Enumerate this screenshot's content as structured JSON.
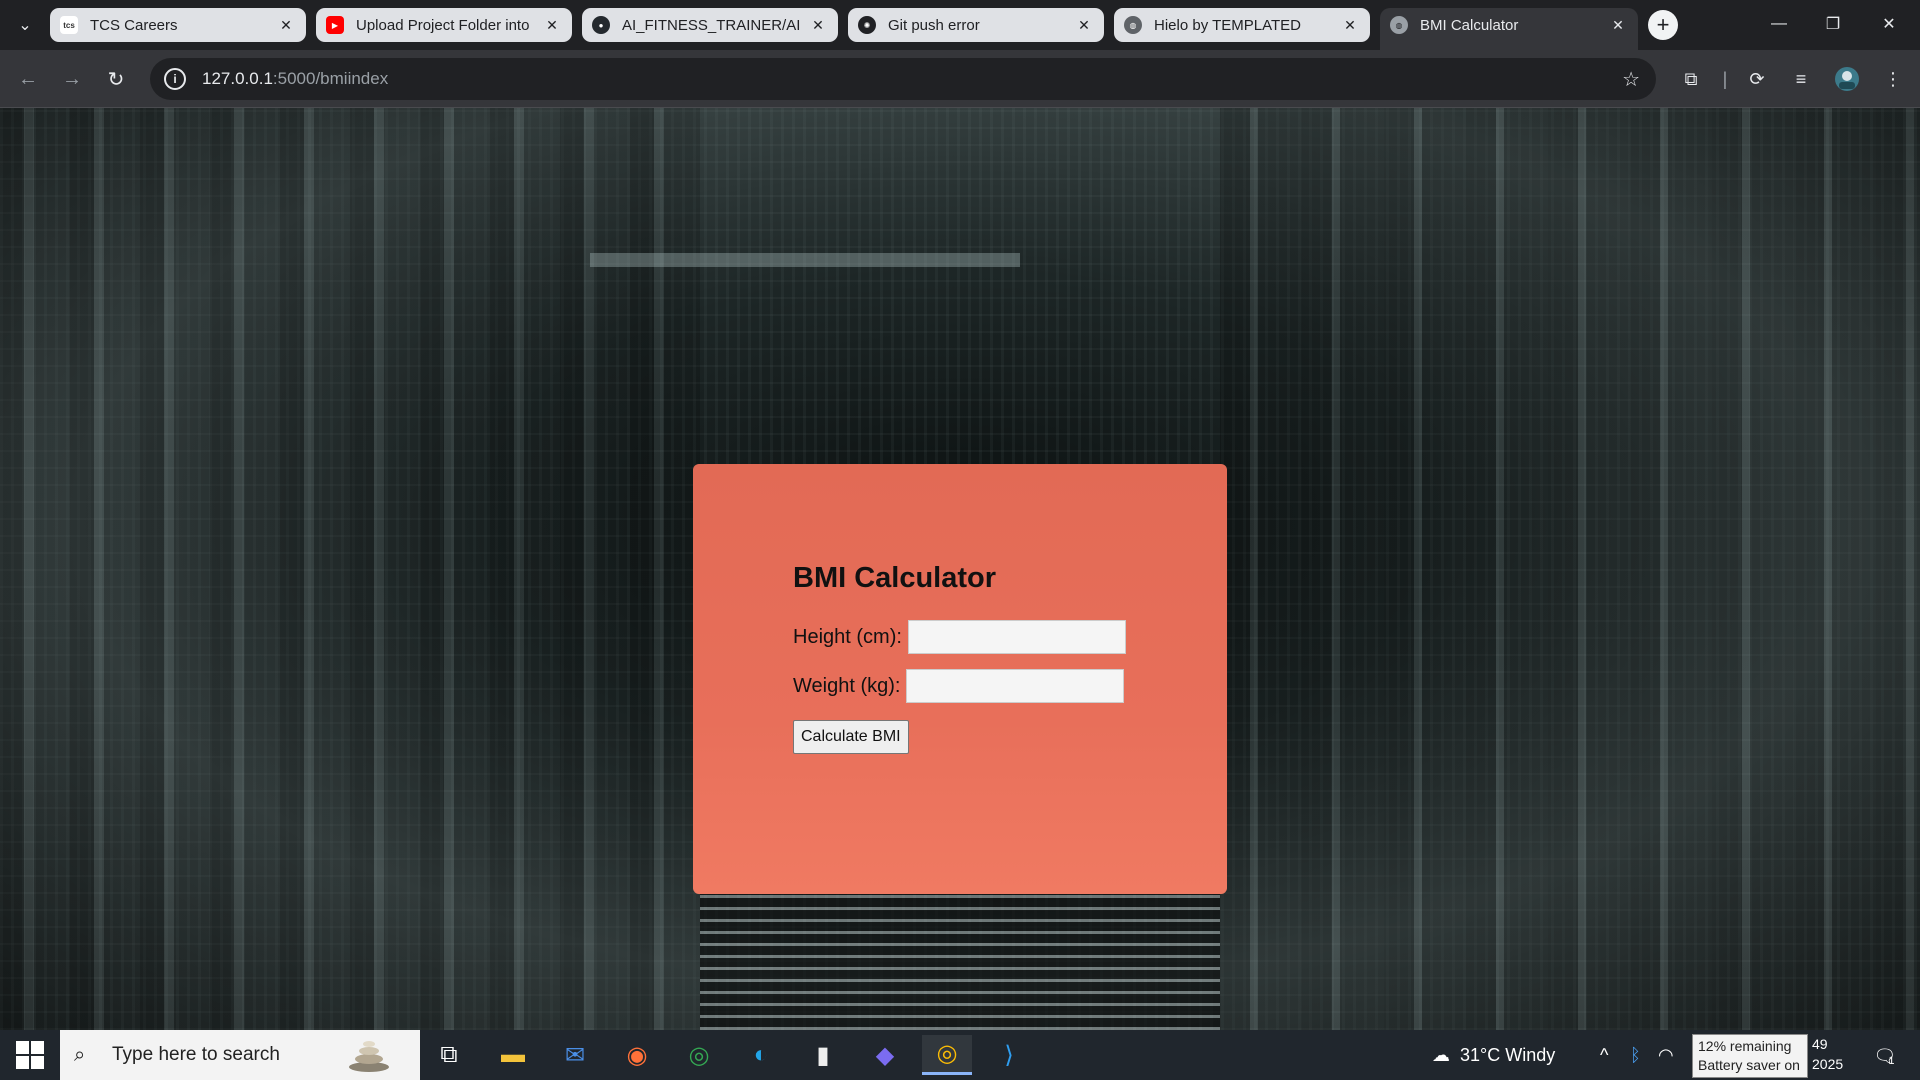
{
  "browser": {
    "tabs": [
      {
        "title": "TCS Careers",
        "favicon": "tcs-icon",
        "color": "#ffffff"
      },
      {
        "title": "Upload Project Folder into",
        "favicon": "youtube-icon",
        "color": "#ff0000"
      },
      {
        "title": "AI_FITNESS_TRAINER/AI_FI",
        "favicon": "github-icon",
        "color": "#24292e"
      },
      {
        "title": "Git push error",
        "favicon": "openai-icon",
        "color": "#202124"
      },
      {
        "title": "Hielo by TEMPLATED",
        "favicon": "globe-icon",
        "color": "#5f6368"
      },
      {
        "title": "BMI Calculator",
        "favicon": "globe-icon",
        "color": "#9aa0a6"
      }
    ],
    "url_host": "127.0.0.1",
    "url_path": ":5000/bmiindex"
  },
  "page": {
    "heading": "BMI Calculator",
    "height_label": "Height (cm):",
    "height_value": "",
    "weight_label": "Weight (kg):",
    "weight_value": "",
    "button_label": "Calculate BMI",
    "card_color": "#e8705a"
  },
  "taskbar": {
    "search_placeholder": "Type here to search",
    "weather": "31°C  Windy",
    "battery_line1": "12% remaining",
    "battery_line2": "Battery saver on",
    "clock_time": "49",
    "clock_date": "2025",
    "notification_count": "1"
  }
}
